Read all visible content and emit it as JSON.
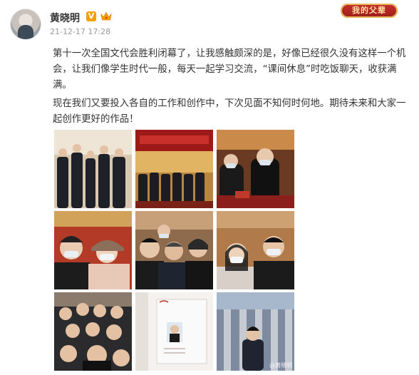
{
  "post": {
    "author": "黄晓明",
    "verified_badge": "V",
    "timestamp": "21-12-17 17:28",
    "banner": "我的父辈",
    "paragraphs": [
      "第十一次全国文代会胜利闭幕了，让我感触颇深的是，好像已经很久没有这样一个机会，让我们像学生时代一般，每天一起学习交流，“课间休息”时吃饭聊天，收获满满。",
      "现在我们又要投入各自的工作和创作中，下次见面不知何时何地。期待未来和大家一起创作更好的作品！"
    ],
    "photo_watermark": "@黄晓明"
  },
  "photos": [
    {
      "name": "photo-group-hall"
    },
    {
      "name": "photo-stage-banner"
    },
    {
      "name": "photo-meeting-masks"
    },
    {
      "name": "photo-selfie-hat"
    },
    {
      "name": "photo-selfie-group"
    },
    {
      "name": "photo-selfie-masks"
    },
    {
      "name": "photo-crowd-selfie"
    },
    {
      "name": "photo-certificate"
    },
    {
      "name": "photo-building-exterior"
    }
  ],
  "colors": {
    "name": "#333333",
    "meta": "#999999",
    "badge": "#f59e00",
    "banner": "#b12622"
  }
}
